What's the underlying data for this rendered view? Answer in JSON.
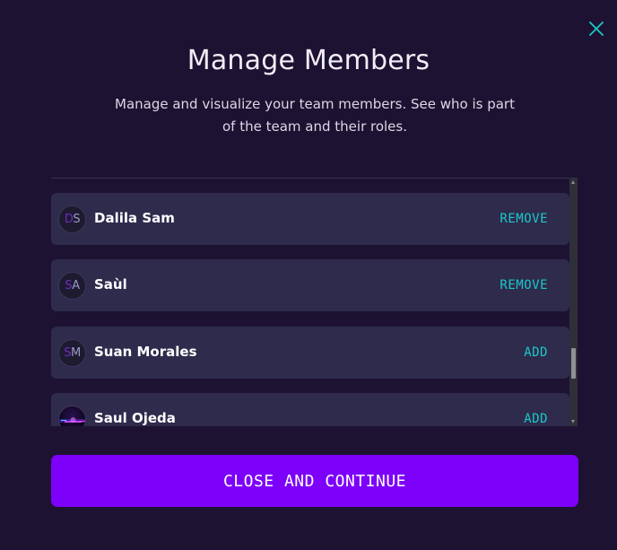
{
  "modal": {
    "title": "Manage Members",
    "subtitle_line1": "Manage and visualize your team members. See who is part",
    "subtitle_line2": "of the team and their roles.",
    "close_icon": "close-icon",
    "accent_color": "#1cc8c8",
    "primary_color": "#7d00fa"
  },
  "members": [
    {
      "name": "Dalila Sam",
      "initials": [
        "D",
        "S"
      ],
      "action": "REMOVE",
      "avatar": "initials"
    },
    {
      "name": "Saùl",
      "initials": [
        "S",
        "A"
      ],
      "action": "REMOVE",
      "avatar": "initials"
    },
    {
      "name": "Suan Morales",
      "initials": [
        "S",
        "M"
      ],
      "action": "ADD",
      "avatar": "initials"
    },
    {
      "name": "Saul Ojeda",
      "initials": [],
      "action": "ADD",
      "avatar": "image"
    }
  ],
  "footer": {
    "continue_label": "CLOSE AND CONTINUE"
  }
}
